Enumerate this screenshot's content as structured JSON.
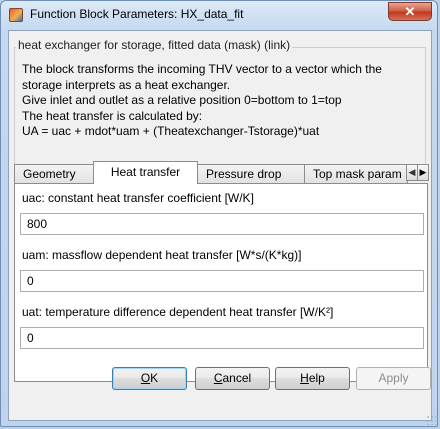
{
  "window": {
    "title": "Function Block Parameters: HX_data_fit",
    "close_glyph": "✕"
  },
  "header": {
    "text": "heat exchanger for storage, fitted data (mask) (link)"
  },
  "description": {
    "lines": [
      "The block transforms the incoming THV vector to a vector which the",
      "storage interprets as a heat exchanger.",
      "Give inlet and outlet as a relative position 0=bottom to 1=top",
      "The heat transfer is calculated by:",
      "UA = uac + mdot*uam + (Theatexchanger-Tstorage)*uat"
    ]
  },
  "tabs": [
    {
      "label": "Geometry",
      "active": false
    },
    {
      "label": "Heat transfer",
      "active": true
    },
    {
      "label": "Pressure drop",
      "active": false
    },
    {
      "label": "Top mask param",
      "active": false
    }
  ],
  "tab_scroll": {
    "left_glyph": "◀",
    "right_glyph": "▶"
  },
  "fields": [
    {
      "label": "uac: constant heat transfer coefficient [W/K]",
      "value": "800"
    },
    {
      "label": "uam: massflow dependent heat transfer [W*s/(K*kg)]",
      "value": "0"
    },
    {
      "label": "uat: temperature difference dependent heat transfer [W/K²]",
      "value": "0"
    }
  ],
  "buttons": {
    "ok": {
      "mnemonic": "O",
      "rest": "K"
    },
    "cancel": {
      "mnemonic": "C",
      "rest": "ancel"
    },
    "help": {
      "mnemonic": "H",
      "rest": "elp"
    },
    "apply": {
      "label": "Apply",
      "disabled": true
    }
  }
}
